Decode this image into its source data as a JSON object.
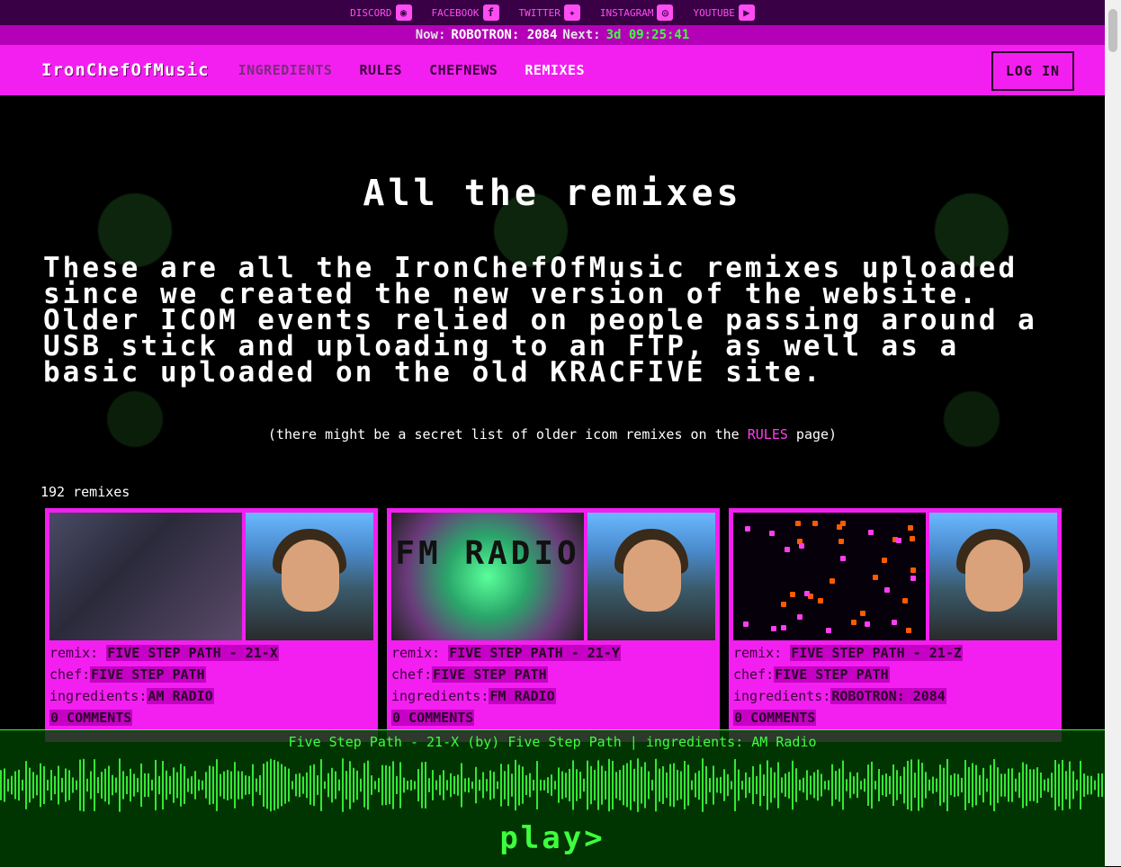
{
  "social": {
    "items": [
      {
        "label": "DISCORD",
        "icon": "discord-icon",
        "glyph": "◉"
      },
      {
        "label": "FACEBOOK",
        "icon": "facebook-icon",
        "glyph": "f"
      },
      {
        "label": "TWITTER",
        "icon": "twitter-icon",
        "glyph": "✦"
      },
      {
        "label": "INSTAGRAM",
        "icon": "instagram-icon",
        "glyph": "◎"
      },
      {
        "label": "YOUTUBE",
        "icon": "youtube-icon",
        "glyph": "▶"
      }
    ]
  },
  "now_bar": {
    "now_label": "Now:",
    "now_value": "ROBOTRON: 2084",
    "next_label": "Next:",
    "countdown": "3d 09:25:41"
  },
  "nav": {
    "brand": "IronChefOfMusic",
    "links": [
      "INGREDIENTS",
      "RULES",
      "CHEFNEWS",
      "REMIXES"
    ],
    "login": "LOG IN"
  },
  "main": {
    "title": "All the remixes",
    "intro": "These are all the IronChefOfMusic remixes uploaded since we created the new version of the website. Older ICOM events relied on people passing around a USB stick and uploading to an FTP, as well as a basic uploaded on the old KRACFIVE site.",
    "note_before": "(there might be a secret list of older icom remixes on the ",
    "note_link": "RULES",
    "note_after": " page)",
    "count": "192 remixes"
  },
  "cards": [
    {
      "remix_label": "remix:",
      "remix": "FIVE STEP PATH - 21-X",
      "chef_label": "chef:",
      "chef": "FIVE STEP PATH",
      "ingredients_label": "ingredients:",
      "ingredients": "AM RADIO",
      "comments": "0 COMMENTS"
    },
    {
      "remix_label": "remix:",
      "remix": "FIVE STEP PATH - 21-Y",
      "chef_label": "chef:",
      "chef": "FIVE STEP PATH",
      "ingredients_label": "ingredients:",
      "ingredients": "FM RADIO",
      "comments": "0 COMMENTS",
      "thumb_text": "FM RADIO"
    },
    {
      "remix_label": "remix:",
      "remix": "FIVE STEP PATH - 21-Z",
      "chef_label": "chef:",
      "chef": "FIVE STEP PATH",
      "ingredients_label": "ingredients:",
      "ingredients": "ROBOTRON: 2084",
      "comments": "0 COMMENTS"
    }
  ],
  "player": {
    "now_playing": "Five Step Path - 21-X (by) Five Step Path | ingredients: AM Radio",
    "play_label": "play>"
  },
  "colors": {
    "accent": "#f31ff0",
    "player_green": "#3dff3d"
  }
}
